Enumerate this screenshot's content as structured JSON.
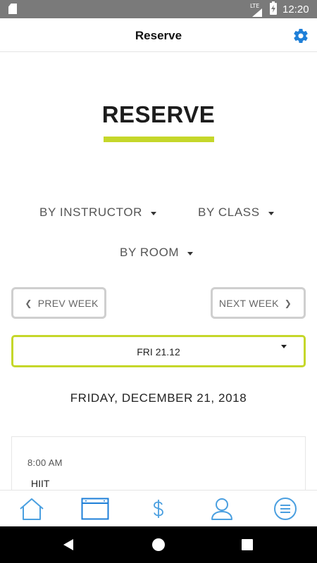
{
  "status_bar": {
    "network": "LTE",
    "time": "12:20"
  },
  "header": {
    "title": "Reserve"
  },
  "page": {
    "title": "RESERVE",
    "accent_color": "#c5d72a"
  },
  "filters": {
    "instructor_label": "BY INSTRUCTOR",
    "class_label": "BY CLASS",
    "room_label": "BY ROOM"
  },
  "week_nav": {
    "prev_label": "PREV WEEK",
    "next_label": "NEXT WEEK"
  },
  "date_select": {
    "selected": "FRI 21.12"
  },
  "schedule": {
    "date_heading": "FRIDAY, DECEMBER 21, 2018",
    "classes": [
      {
        "time": "8:00 AM",
        "name": "HIIT"
      }
    ]
  },
  "bottom_nav": {
    "items": [
      "home-icon",
      "calendar-icon",
      "dollar-icon",
      "profile-icon",
      "menu-icon"
    ],
    "active": "calendar-icon",
    "icon_color": "#4a9fe0"
  }
}
